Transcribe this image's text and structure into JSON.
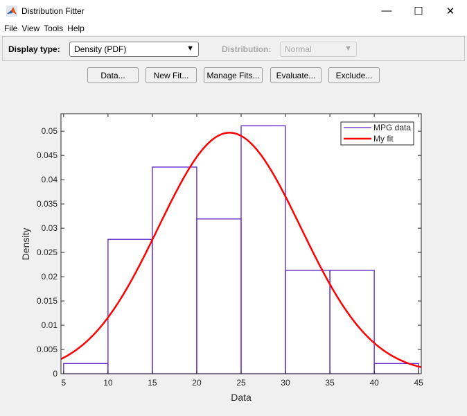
{
  "window": {
    "title": "Distribution Fitter",
    "minimize": "—",
    "maximize": "☐",
    "close": "✕"
  },
  "menu": [
    "File",
    "View",
    "Tools",
    "Help"
  ],
  "controls": {
    "display_type_label": "Display type:",
    "display_type_value": "Density (PDF)",
    "distribution_label": "Distribution:",
    "distribution_value": "Normal"
  },
  "buttons": [
    "Data...",
    "New Fit...",
    "Manage Fits...",
    "Evaluate...",
    "Exclude..."
  ],
  "chart_data": {
    "type": "bar",
    "title": "",
    "xlabel": "Data",
    "ylabel": "Density",
    "xlim": [
      4.7,
      45.3
    ],
    "ylim": [
      0,
      0.0536
    ],
    "xticks": [
      5,
      10,
      15,
      20,
      25,
      30,
      35,
      40,
      45
    ],
    "yticks": [
      0,
      0.005,
      0.01,
      0.015,
      0.02,
      0.025,
      0.03,
      0.035,
      0.04,
      0.045,
      0.05
    ],
    "ytick_labels": [
      "0",
      "0.005",
      "0.01",
      "0.015",
      "0.02",
      "0.025",
      "0.03",
      "0.035",
      "0.04",
      "0.045",
      "0.05"
    ],
    "legend": {
      "placement": "top-right",
      "entries": [
        "MPG data",
        "My fit"
      ]
    },
    "series": [
      {
        "name": "MPG data",
        "kind": "histogram",
        "bin_edges": [
          5,
          10,
          15,
          20,
          25,
          30,
          35,
          40,
          45
        ],
        "values": [
          0.0021,
          0.0277,
          0.0426,
          0.0319,
          0.0511,
          0.0213,
          0.0213,
          0.0021
        ],
        "color": "#5a1ec8"
      },
      {
        "name": "My fit",
        "kind": "normal-pdf",
        "mu": 23.7,
        "sigma": 8.03,
        "color": "#ff0000"
      }
    ]
  }
}
